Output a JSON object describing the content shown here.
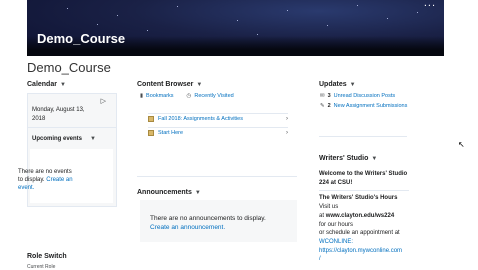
{
  "banner": {
    "title": "Demo_Course",
    "menu_label": "..."
  },
  "page": {
    "title": "Demo_Course"
  },
  "calendar": {
    "title": "Calendar",
    "date": "Monday, August 13, 2018",
    "upcoming_label": "Upcoming events",
    "no_events": "There are no events to display.",
    "create_link": "Create an event."
  },
  "content_browser": {
    "title": "Content Browser",
    "bookmarks": "Bookmarks",
    "recently_visited": "Recently Visited",
    "items": [
      {
        "label": "Fall 2018: Assignments & Activities"
      },
      {
        "label": "Start Here"
      }
    ]
  },
  "announcements": {
    "title": "Announcements",
    "empty": "There are no announcements to display.",
    "create_link": "Create an announcement."
  },
  "updates": {
    "title": "Updates",
    "items": [
      {
        "count": "3",
        "label": "Unread Discussion Posts"
      },
      {
        "count": "2",
        "label": "New Assignment Submissions"
      }
    ]
  },
  "writers_studio": {
    "title": "Writers' Studio",
    "welcome": "Welcome to the Writers' Studio 224 at CSU!",
    "hours_heading": "The Writers' Studio's Hours",
    "visit_us": "Visit us",
    "at": "at",
    "website": "www.clayton.edu/ws224",
    "for_hours": "for our hours",
    "schedule": "or schedule an appointment at",
    "wconline": "WCONLINE:",
    "wconline_url": "https://clayton.mywconline.com",
    "slash": "/"
  },
  "role_switch": {
    "title": "Role Switch",
    "sub": "Current Role"
  }
}
